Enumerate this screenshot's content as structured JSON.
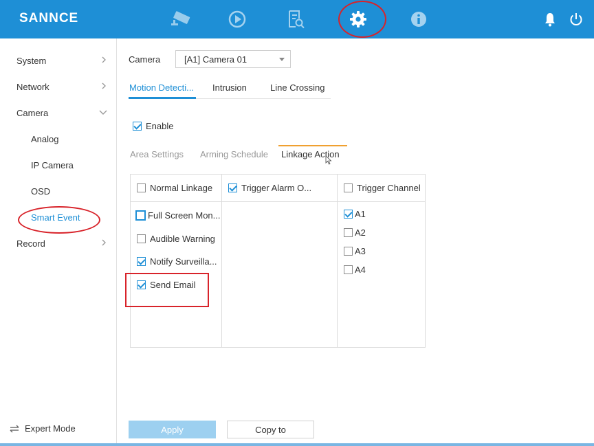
{
  "brand": {
    "logo": "SANNCE"
  },
  "colors": {
    "accent": "#1e8fd6",
    "topbar": "#1e8fd6",
    "highlight": "#d8232a",
    "subtab_indicator": "#f0a030"
  },
  "topnav": [
    {
      "icon": "camera-icon"
    },
    {
      "icon": "playback-icon"
    },
    {
      "icon": "search-file-icon"
    },
    {
      "icon": "gear-icon",
      "active": true
    },
    {
      "icon": "info-icon"
    }
  ],
  "topright": [
    {
      "icon": "bell-icon"
    },
    {
      "icon": "power-icon"
    }
  ],
  "sidebar": {
    "items": [
      {
        "label": "System"
      },
      {
        "label": "Network"
      },
      {
        "label": "Camera"
      },
      {
        "label": "Analog"
      },
      {
        "label": "IP Camera"
      },
      {
        "label": "OSD"
      },
      {
        "label": "Smart Event"
      },
      {
        "label": "Record"
      }
    ],
    "expert_mode": "Expert Mode"
  },
  "camera": {
    "label": "Camera",
    "selected": "[A1] Camera 01"
  },
  "detection_tabs": [
    {
      "label": "Motion Detecti..."
    },
    {
      "label": "Intrusion"
    },
    {
      "label": "Line Crossing"
    }
  ],
  "enable": {
    "label": "Enable",
    "checked": true
  },
  "settings_tabs": [
    {
      "label": "Area Settings"
    },
    {
      "label": "Arming Schedule"
    },
    {
      "label": "Linkage Action"
    }
  ],
  "linkage": {
    "normal": {
      "header": "Normal Linkage",
      "header_checked": false,
      "items": [
        {
          "label": "Full Screen Mon...",
          "checked": false
        },
        {
          "label": "Audible Warning",
          "checked": false
        },
        {
          "label": "Notify Surveilla...",
          "checked": true
        },
        {
          "label": "Send Email",
          "checked": true
        }
      ]
    },
    "alarm": {
      "header": "Trigger Alarm O...",
      "header_checked": true
    },
    "channel": {
      "header": "Trigger Channel",
      "header_checked": false,
      "items": [
        {
          "label": "A1",
          "checked": true
        },
        {
          "label": "A2",
          "checked": false
        },
        {
          "label": "A3",
          "checked": false
        },
        {
          "label": "A4",
          "checked": false
        }
      ]
    }
  },
  "buttons": {
    "apply": "Apply",
    "copy": "Copy to"
  }
}
